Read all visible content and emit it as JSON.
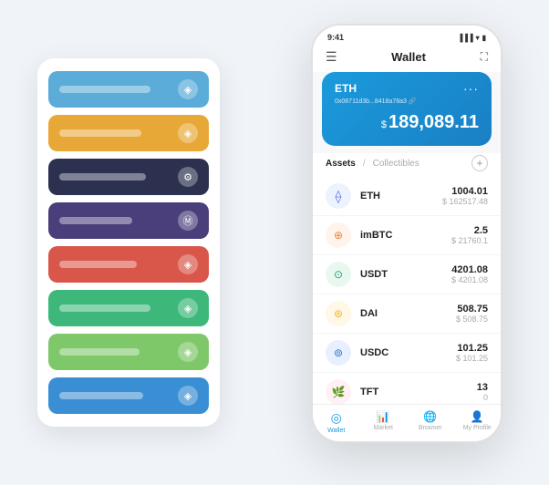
{
  "scene": {
    "background": "#f0f4f8"
  },
  "leftPanel": {
    "cards": [
      {
        "color": "card-blue",
        "barWidth": "100px",
        "icon": "◈"
      },
      {
        "color": "card-yellow",
        "barWidth": "90px",
        "icon": "◈"
      },
      {
        "color": "card-dark",
        "barWidth": "95px",
        "icon": "⚙"
      },
      {
        "color": "card-purple",
        "barWidth": "80px",
        "icon": "Ⓜ"
      },
      {
        "color": "card-red",
        "barWidth": "85px",
        "icon": "◈"
      },
      {
        "color": "card-green",
        "barWidth": "100px",
        "icon": "◈"
      },
      {
        "color": "card-light-green",
        "barWidth": "88px",
        "icon": "◈"
      },
      {
        "color": "card-blue2",
        "barWidth": "92px",
        "icon": "◈"
      }
    ]
  },
  "phone": {
    "statusBar": {
      "time": "9:41",
      "signal": "▐▐▐",
      "wifi": "📶",
      "battery": "🔋"
    },
    "header": {
      "menuIcon": "☰",
      "title": "Wallet",
      "scanIcon": "⛶"
    },
    "ethCard": {
      "label": "ETH",
      "dots": "···",
      "address": "0x08711d3b...8418a78a3 🔗",
      "currencySymbol": "$",
      "balance": "189,089.11"
    },
    "assetsTabs": {
      "active": "Assets",
      "divider": "/",
      "inactive": "Collectibles"
    },
    "assetsAddIcon": "+",
    "assets": [
      {
        "name": "ETH",
        "icon": "⟠",
        "iconBg": "#ecf3ff",
        "iconColor": "#6272dd",
        "amount": "1004.01",
        "usd": "$ 162517.48"
      },
      {
        "name": "imBTC",
        "icon": "⊕",
        "iconBg": "#fff3ec",
        "iconColor": "#e8873a",
        "amount": "2.5",
        "usd": "$ 21760.1"
      },
      {
        "name": "USDT",
        "icon": "⊙",
        "iconBg": "#e8f8ef",
        "iconColor": "#26a17b",
        "amount": "4201.08",
        "usd": "$ 4201.08"
      },
      {
        "name": "DAI",
        "icon": "⊛",
        "iconBg": "#fff8e6",
        "iconColor": "#f4b731",
        "amount": "508.75",
        "usd": "$ 508.75"
      },
      {
        "name": "USDC",
        "icon": "⊚",
        "iconBg": "#e8f0ff",
        "iconColor": "#2775ca",
        "amount": "101.25",
        "usd": "$ 101.25"
      },
      {
        "name": "TFT",
        "icon": "🌿",
        "iconBg": "#fff0f5",
        "iconColor": "#e85d87",
        "amount": "13",
        "usd": "0"
      }
    ],
    "bottomNav": [
      {
        "label": "Wallet",
        "icon": "◎",
        "active": true
      },
      {
        "label": "Market",
        "icon": "📈",
        "active": false
      },
      {
        "label": "Browser",
        "icon": "👤",
        "active": false
      },
      {
        "label": "My Profile",
        "icon": "👤",
        "active": false
      }
    ]
  }
}
